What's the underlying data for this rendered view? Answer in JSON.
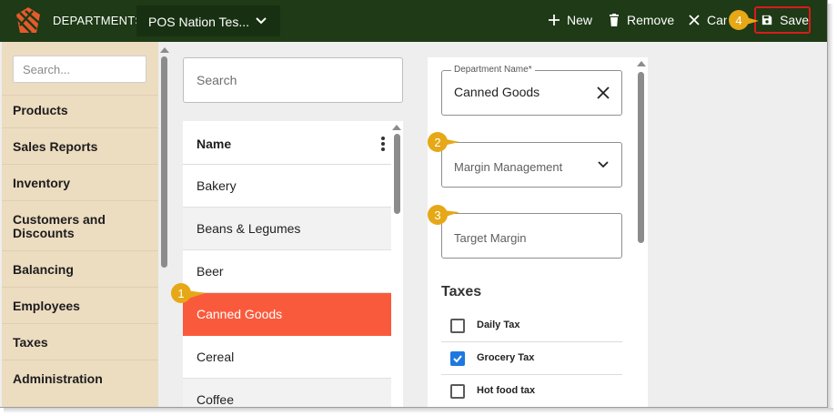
{
  "header": {
    "app_title": "DEPARTMENTS",
    "store_selector": "POS Nation Tes...",
    "new_label": "New",
    "remove_label": "Remove",
    "cancel_label": "Cancel",
    "save_label": "Save"
  },
  "sidebar": {
    "search_placeholder": "Search...",
    "items": [
      {
        "label": "Products"
      },
      {
        "label": "Sales Reports"
      },
      {
        "label": "Inventory"
      },
      {
        "label": "Customers and Discounts"
      },
      {
        "label": "Balancing"
      },
      {
        "label": "Employees"
      },
      {
        "label": "Taxes"
      },
      {
        "label": "Administration"
      }
    ]
  },
  "list": {
    "search_placeholder": "Search",
    "column_header": "Name",
    "rows": [
      {
        "label": "Bakery"
      },
      {
        "label": "Beans & Legumes"
      },
      {
        "label": "Beer"
      },
      {
        "label": "Canned Goods",
        "selected": true
      },
      {
        "label": "Cereal"
      },
      {
        "label": "Coffee"
      }
    ]
  },
  "form": {
    "department_name_label": "Department Name*",
    "department_name_value": "Canned Goods",
    "margin_management_placeholder": "Margin Management",
    "target_margin_placeholder": "Target Margin",
    "taxes_heading": "Taxes",
    "taxes": [
      {
        "label": "Daily Tax",
        "checked": false
      },
      {
        "label": "Grocery Tax",
        "checked": true
      },
      {
        "label": "Hot food tax",
        "checked": false
      }
    ]
  },
  "callouts": [
    "1",
    "2",
    "3",
    "4"
  ],
  "colors": {
    "topbar": "#1e3a16",
    "sidebar": "#ecdcc0",
    "selected_row": "#fa5a3c",
    "callout": "#e6a817",
    "checkbox_checked": "#1f78e0",
    "save_highlight": "#d81b1b"
  }
}
